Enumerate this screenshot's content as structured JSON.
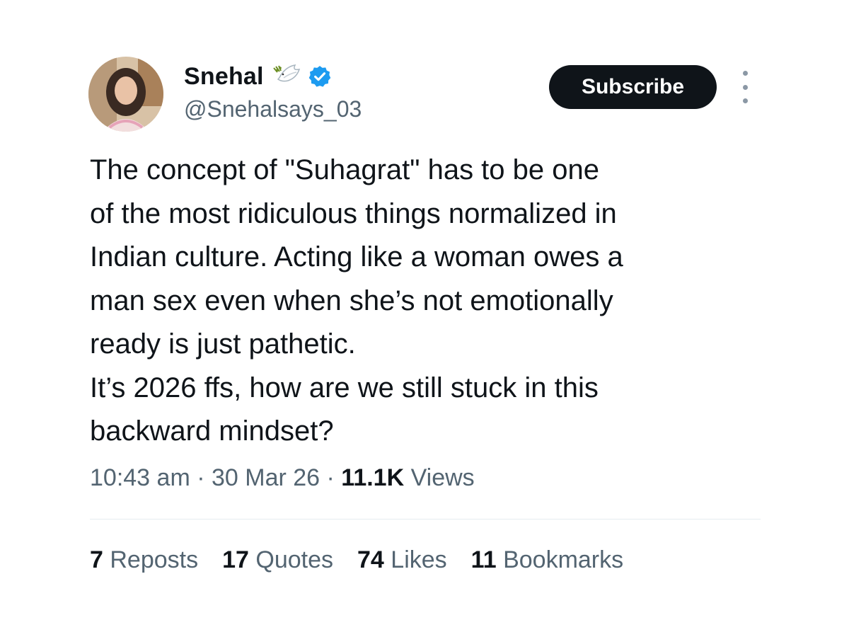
{
  "author": {
    "display_name": "Snehal",
    "handle": "@Snehalsays_03",
    "avatar_icon": "avatar-photo",
    "badge_icon": "dove-emoji-icon",
    "verified_icon": "verified-badge-icon",
    "verified_color": "#1d9bf0"
  },
  "actions": {
    "subscribe_label": "Subscribe",
    "more_icon": "more-vertical-icon"
  },
  "tweet": {
    "text": "The concept of \"Suhagrat\" has to be one\nof the most ridiculous things normalized in\nIndian culture. Acting like a woman owes a\nman sex even when she’s not emotionally\nready is just pathetic.\nIt’s 2026 ffs, how are we still stuck in this\nbackward mindset?"
  },
  "meta": {
    "time": "10:43 am",
    "separator": " · ",
    "date": "30 Mar 26",
    "views_count": "11.1K",
    "views_label": " Views"
  },
  "stats": [
    {
      "count": "7",
      "label": " Reposts"
    },
    {
      "count": "17",
      "label": " Quotes"
    },
    {
      "count": "74",
      "label": " Likes"
    },
    {
      "count": "11",
      "label": " Bookmarks"
    }
  ],
  "colors": {
    "primary_text": "#0f1419",
    "secondary_text": "#536471",
    "button_bg": "#0f1419",
    "divider": "#e6ecf0"
  }
}
